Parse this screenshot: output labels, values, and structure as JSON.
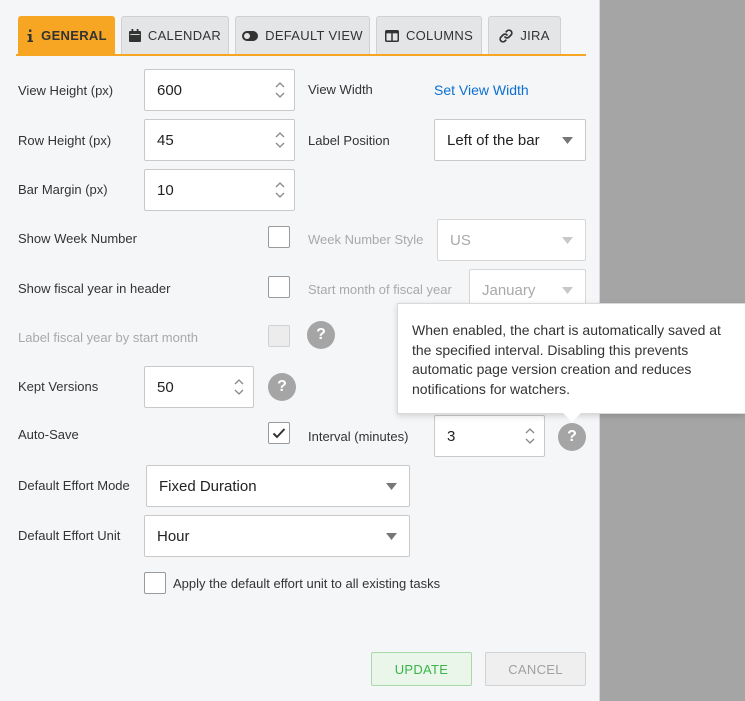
{
  "tabs": [
    {
      "label": "GENERAL",
      "icon": "info-icon",
      "active": true
    },
    {
      "label": "CALENDAR",
      "icon": "calendar-icon"
    },
    {
      "label": "DEFAULT VIEW",
      "icon": "toggle-icon"
    },
    {
      "label": "COLUMNS",
      "icon": "columns-icon"
    },
    {
      "label": "JIRA",
      "icon": "link-icon"
    }
  ],
  "fields": {
    "view_height": {
      "label": "View Height (px)",
      "value": "600"
    },
    "view_width": {
      "label": "View Width",
      "link": "Set View Width"
    },
    "row_height": {
      "label": "Row Height (px)",
      "value": "45"
    },
    "label_position": {
      "label": "Label Position",
      "value": "Left of the bar"
    },
    "bar_margin": {
      "label": "Bar Margin (px)",
      "value": "10"
    },
    "show_week_number": {
      "label": "Show Week Number",
      "checked": false
    },
    "week_number_style": {
      "label": "Week Number Style",
      "value": "US"
    },
    "show_fiscal_year": {
      "label": "Show fiscal year in header",
      "checked": false
    },
    "fiscal_start_month": {
      "label": "Start month of fiscal year",
      "value": "January"
    },
    "label_fiscal_year": {
      "label": "Label fiscal year by start month",
      "checked": false
    },
    "kept_versions": {
      "label": "Kept Versions",
      "value": "50"
    },
    "auto_save": {
      "label": "Auto-Save",
      "checked": true
    },
    "interval": {
      "label": "Interval (minutes)",
      "value": "3"
    },
    "effort_mode": {
      "label": "Default Effort Mode",
      "value": "Fixed Duration"
    },
    "effort_unit": {
      "label": "Default Effort Unit",
      "value": "Hour"
    },
    "apply_unit": {
      "label": "Apply the default effort unit to all existing tasks",
      "checked": false
    }
  },
  "help_glyph": "?",
  "tooltip": {
    "text": "When enabled, the chart is automatically saved at the specified interval. Disabling this prevents automatic page version creation and reduces notifications for watchers."
  },
  "buttons": {
    "update": "UPDATE",
    "cancel": "CANCEL"
  },
  "colors": {
    "accent": "#f6a623",
    "link": "#0b6fd1",
    "update_text": "#39b54a",
    "overlay": "#a5a5a5"
  }
}
